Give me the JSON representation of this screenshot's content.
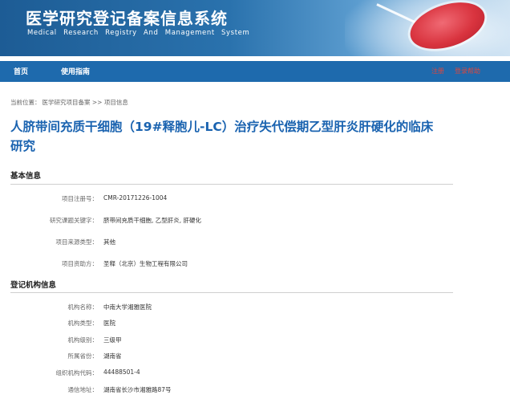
{
  "header": {
    "title": "医学研究登记备案信息系统",
    "subtitle": "Medical Research Registry And Management System"
  },
  "nav": {
    "items": [
      "首页",
      "使用指南"
    ],
    "right_links": [
      "注册",
      "登录帮助"
    ]
  },
  "breadcrumb": {
    "prefix": "当前位置：",
    "path": "医学研究项目备案 >> 项目信息"
  },
  "project": {
    "title_line1": "人脐带间充质干细胞（19#释胞儿-LC）治疗失代偿期乙型肝炎肝硬化的临床",
    "title_line2": "研究"
  },
  "basic_info": {
    "heading": "基本信息",
    "fields": [
      {
        "label": "项目注册号：",
        "value": "CMR-20171226-1004"
      },
      {
        "label": "研究课题关键字：",
        "value": "脐带间充质干细胞, 乙型肝炎, 肝硬化"
      },
      {
        "label": "项目来源类型：",
        "value": "其他"
      },
      {
        "label": "项目资助方：",
        "value": "圣释（北京）生物工程有限公司"
      }
    ]
  },
  "institution_info": {
    "heading": "登记机构信息",
    "fields": [
      {
        "label": "机构名称：",
        "value": "中南大学湘雅医院"
      },
      {
        "label": "机构类型：",
        "value": "医院"
      },
      {
        "label": "机构级别：",
        "value": "三级甲"
      },
      {
        "label": "所属省份：",
        "value": "湖南省"
      },
      {
        "label": "组织机构代码：",
        "value": "44488501-4"
      },
      {
        "label": "通信地址：",
        "value": "湖南省长沙市湘雅路87号"
      }
    ]
  },
  "colors": {
    "nav_bg": "#1e6aad",
    "title_blue": "#1a63b0",
    "nav_link_red": "#e0463c"
  }
}
